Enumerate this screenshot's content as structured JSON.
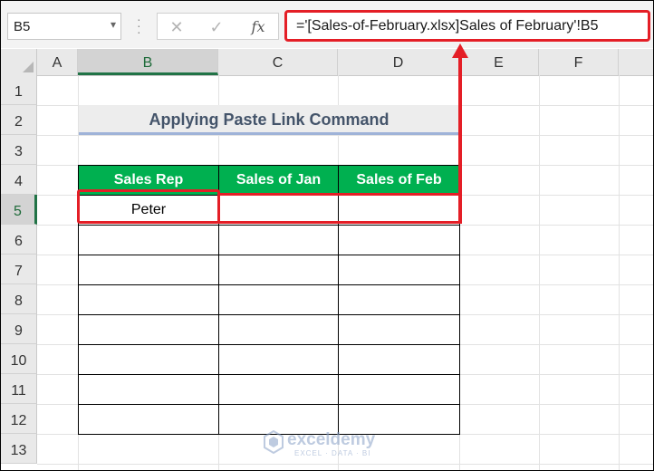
{
  "formula_bar": {
    "name_box": "B5",
    "cancel_icon": "✕",
    "enter_icon": "✓",
    "fx_label": "fx",
    "formula": "='[Sales-of-February.xlsx]Sales of February'!B5"
  },
  "columns": [
    "A",
    "B",
    "C",
    "D",
    "E",
    "F"
  ],
  "active_column": "B",
  "rows": [
    "1",
    "2",
    "3",
    "4",
    "5",
    "6",
    "7",
    "8",
    "9",
    "10",
    "11",
    "12",
    "13"
  ],
  "active_row": "5",
  "sheet": {
    "title": "Applying Paste Link Command",
    "table": {
      "headers": [
        "Sales Rep",
        "Sales of Jan",
        "Sales of Feb"
      ],
      "rows": [
        [
          "Peter",
          "",
          ""
        ],
        [
          "",
          "",
          ""
        ],
        [
          "",
          "",
          ""
        ],
        [
          "",
          "",
          ""
        ],
        [
          "",
          "",
          ""
        ],
        [
          "",
          "",
          ""
        ],
        [
          "",
          "",
          ""
        ],
        [
          "",
          "",
          ""
        ]
      ]
    }
  },
  "watermark": {
    "name": "exceldemy",
    "tagline": "EXCEL · DATA · BI"
  },
  "colors": {
    "header_green": "#00b050",
    "highlight_red": "#e41e26",
    "title_text": "#44546a",
    "active_header": "#217346"
  }
}
